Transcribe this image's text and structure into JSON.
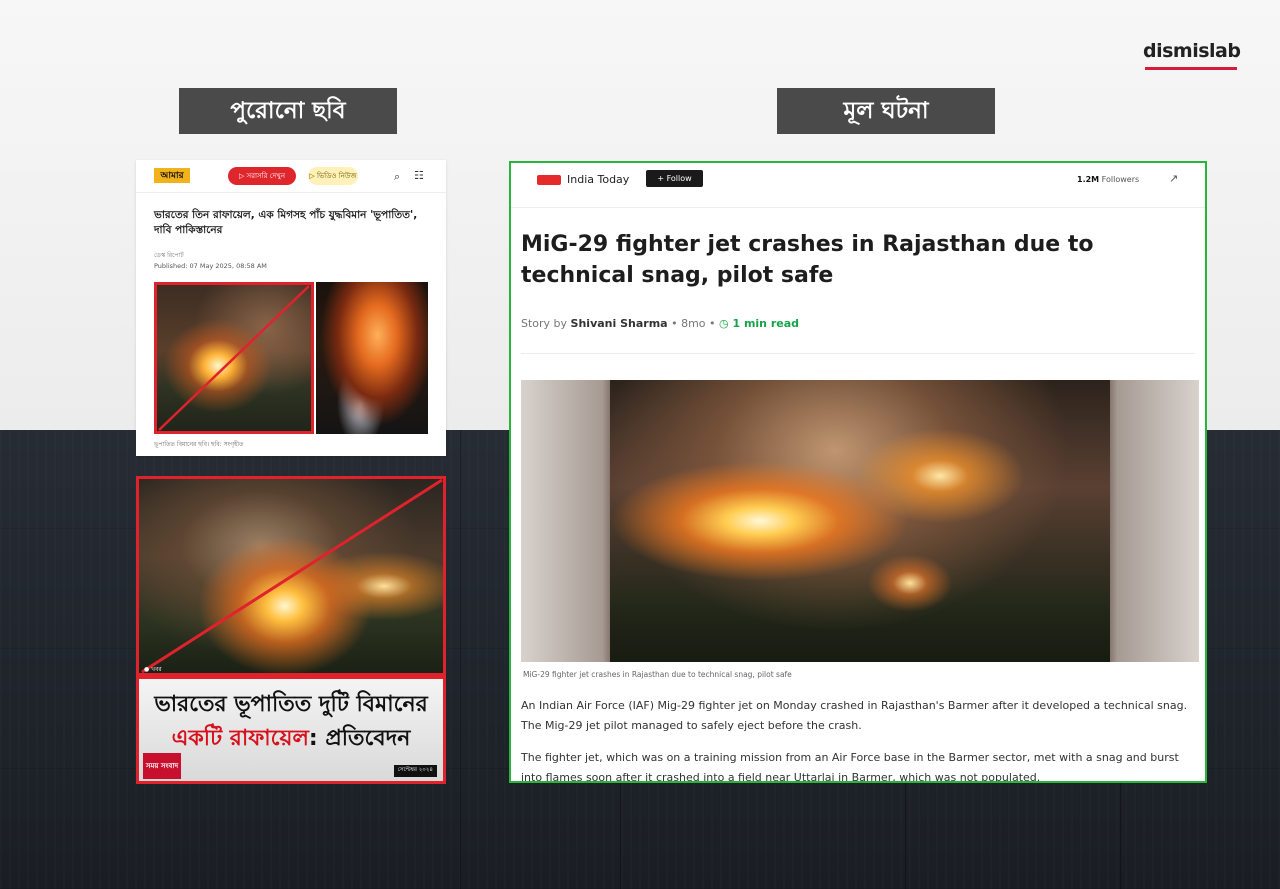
{
  "brand": {
    "logo_text": "dismislab",
    "accent": "#d21d3b"
  },
  "labels": {
    "left": "পুরোনো ছবি",
    "right": "মূল ঘটনা"
  },
  "left_top_card": {
    "nav_logo": "আমার",
    "nav_pill_red": "▷ সরাসরি দেখুন",
    "nav_pill_yellow": "▷ ভিডিও নিউজ",
    "search_icon": "⌕",
    "menu_icon": "☷",
    "headline": "ভারতের তিন রাফায়েল, এক মিগসহ পাঁচ যুদ্ধবিমান 'ভূপাতিত', দাবি পাকিস্তানের",
    "byline": "ডেস্ক রিপোর্ট",
    "published": "Published: 07 May 2025, 08:58 AM",
    "caption": "ভূপাতিত বিমানের ছবি। ছবি: সংগৃহীত"
  },
  "left_bottom_card": {
    "tag": "● খবর",
    "title_line1": "ভারতের ভূপাতিত দুটি বিমানের",
    "title_line2_red": "একটি রাফায়েল",
    "title_line2_rest": ": প্রতিবেদন",
    "channel_logo": "সময় সংবাদ",
    "credit": "সেপ্টেম্বর ২০২৪"
  },
  "right_card": {
    "source": "India Today",
    "follow_label": "+ Follow",
    "followers_count": "1.2M",
    "followers_label": " Followers",
    "share_icon": "↗",
    "headline": "MiG-29 fighter jet crashes in Rajasthan due to technical snag, pilot safe",
    "story_prefix": "Story by ",
    "author": "Shivani Sharma",
    "age": " • 8mo • ",
    "clock_icon": "◷",
    "read_time": " 1 min read",
    "photo_caption": "MiG-29 fighter jet crashes in Rajasthan due to technical snag, pilot safe",
    "paragraph1": "An Indian Air Force (IAF) Mig-29 fighter jet on Monday crashed in Rajasthan's Barmer after it developed a technical snag. The Mig-29 jet pilot managed to safely eject before the crash.",
    "paragraph2": "The fighter jet, which was on a training mission from an Air Force base in the Barmer sector, met with a snag and burst into flames soon after it crashed into a field near Uttarlai in Barmer, which was not populated."
  },
  "colors": {
    "highlight_green": "#27b53a",
    "strike_red": "#e0222d"
  }
}
